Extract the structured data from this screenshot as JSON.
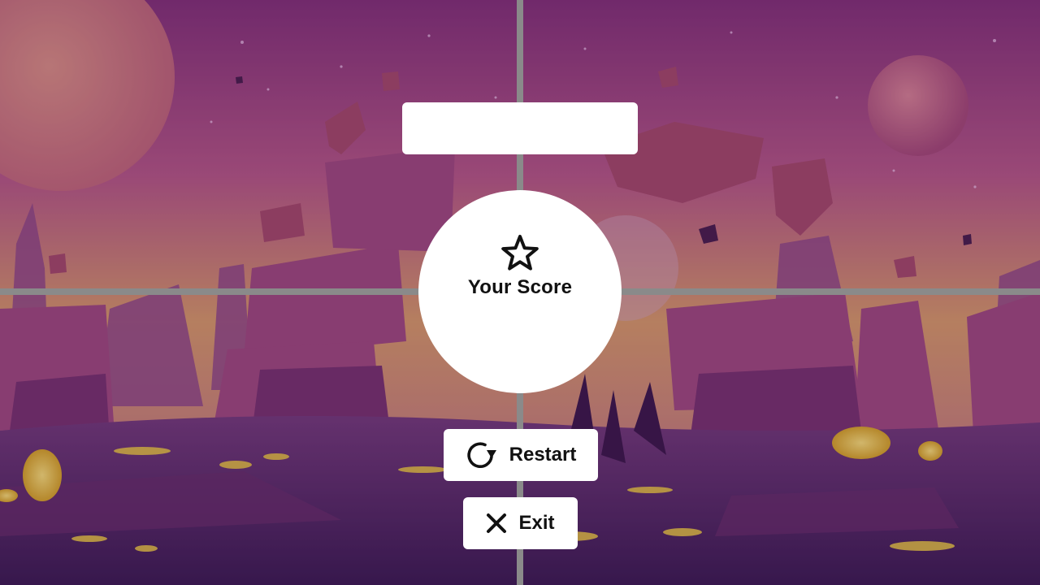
{
  "game": {
    "title": "",
    "score_label": "Your Score",
    "score_value": "",
    "restart_label": "Restart",
    "exit_label": "Exit"
  },
  "icons": {
    "score": "star-icon",
    "restart": "restart-icon",
    "exit": "close-icon"
  },
  "colors": {
    "panel": "#ffffff",
    "text": "#111111",
    "grid_line": "#8a8a8a",
    "sky_top": "#7a2f6a",
    "sky_mid": "#d9a55a",
    "ground": "#3d1f52",
    "glow": "#f2d21a"
  }
}
